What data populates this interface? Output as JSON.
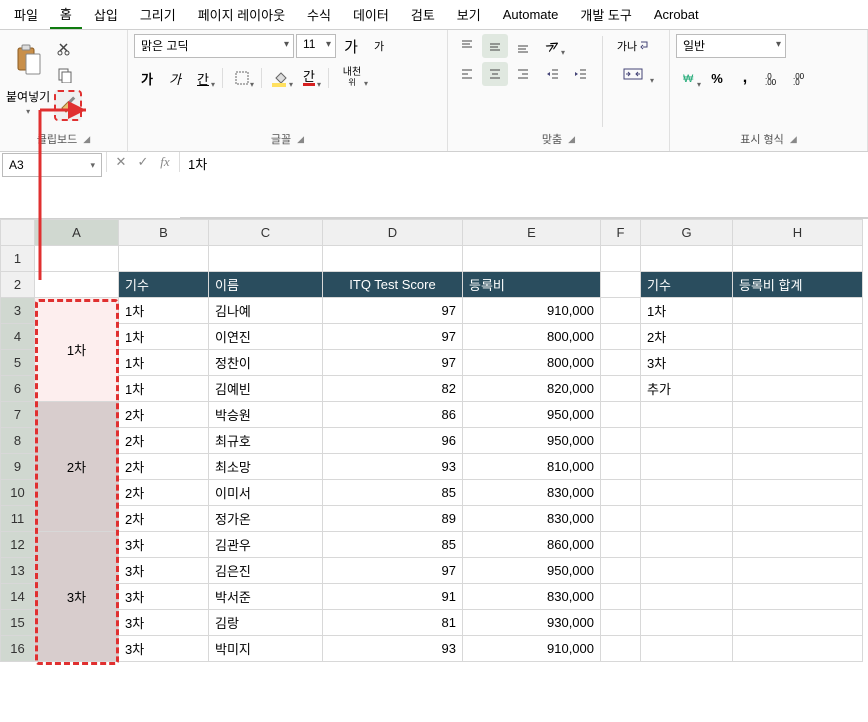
{
  "menu": {
    "file": "파일",
    "home": "홈",
    "insert": "삽입",
    "draw": "그리기",
    "layout": "페이지 레이아웃",
    "formulas": "수식",
    "data": "데이터",
    "review": "검토",
    "view": "보기",
    "automate": "Automate",
    "developer": "개발 도구",
    "acrobat": "Acrobat"
  },
  "ribbon": {
    "clipboard": {
      "paste": "붙여넣기",
      "label": "클립보드"
    },
    "font": {
      "name": "맑은 고딕",
      "size": "11",
      "grow": "가",
      "shrink": "가",
      "bold": "가",
      "italic": "가",
      "underline": "간",
      "ruby": "내천",
      "ruby_sub": "위",
      "font_color": "간",
      "label": "글꼴"
    },
    "align": {
      "wrap": "가나",
      "label": "맞춤"
    },
    "number": {
      "format": "일반",
      "percent": "%",
      "comma": ",",
      "label": "표시 형식"
    }
  },
  "formula_bar": {
    "name_box": "A3",
    "fx": "fx",
    "value": "1차"
  },
  "columns": [
    "A",
    "B",
    "C",
    "D",
    "E",
    "F",
    "G",
    "H"
  ],
  "row_numbers": [
    1,
    2,
    3,
    4,
    5,
    6,
    7,
    8,
    9,
    10,
    11,
    12,
    13,
    14,
    15,
    16
  ],
  "headers": {
    "b": "기수",
    "c": "이름",
    "d": "ITQ Test Score",
    "e": "등록비",
    "g": "기수",
    "h": "등록비 합계"
  },
  "merged": {
    "a1": "1차",
    "a2": "2차",
    "a3": "3차"
  },
  "rows": [
    {
      "b": "1차",
      "c": "김나예",
      "d": "97",
      "e": "910,000",
      "g": "1차"
    },
    {
      "b": "1차",
      "c": "이연진",
      "d": "97",
      "e": "800,000",
      "g": "2차"
    },
    {
      "b": "1차",
      "c": "정찬이",
      "d": "97",
      "e": "800,000",
      "g": "3차"
    },
    {
      "b": "1차",
      "c": "김예빈",
      "d": "82",
      "e": "820,000",
      "g": "추가"
    },
    {
      "b": "2차",
      "c": "박승원",
      "d": "86",
      "e": "950,000",
      "g": ""
    },
    {
      "b": "2차",
      "c": "최규호",
      "d": "96",
      "e": "950,000",
      "g": ""
    },
    {
      "b": "2차",
      "c": "최소망",
      "d": "93",
      "e": "810,000",
      "g": ""
    },
    {
      "b": "2차",
      "c": "이미서",
      "d": "85",
      "e": "830,000",
      "g": ""
    },
    {
      "b": "2차",
      "c": "정가온",
      "d": "89",
      "e": "830,000",
      "g": ""
    },
    {
      "b": "3차",
      "c": "김관우",
      "d": "85",
      "e": "860,000",
      "g": ""
    },
    {
      "b": "3차",
      "c": "김은진",
      "d": "97",
      "e": "950,000",
      "g": ""
    },
    {
      "b": "3차",
      "c": "박서준",
      "d": "91",
      "e": "830,000",
      "g": ""
    },
    {
      "b": "3차",
      "c": "김랑",
      "d": "81",
      "e": "930,000",
      "g": ""
    },
    {
      "b": "3차",
      "c": "박미지",
      "d": "93",
      "e": "910,000",
      "g": ""
    }
  ]
}
